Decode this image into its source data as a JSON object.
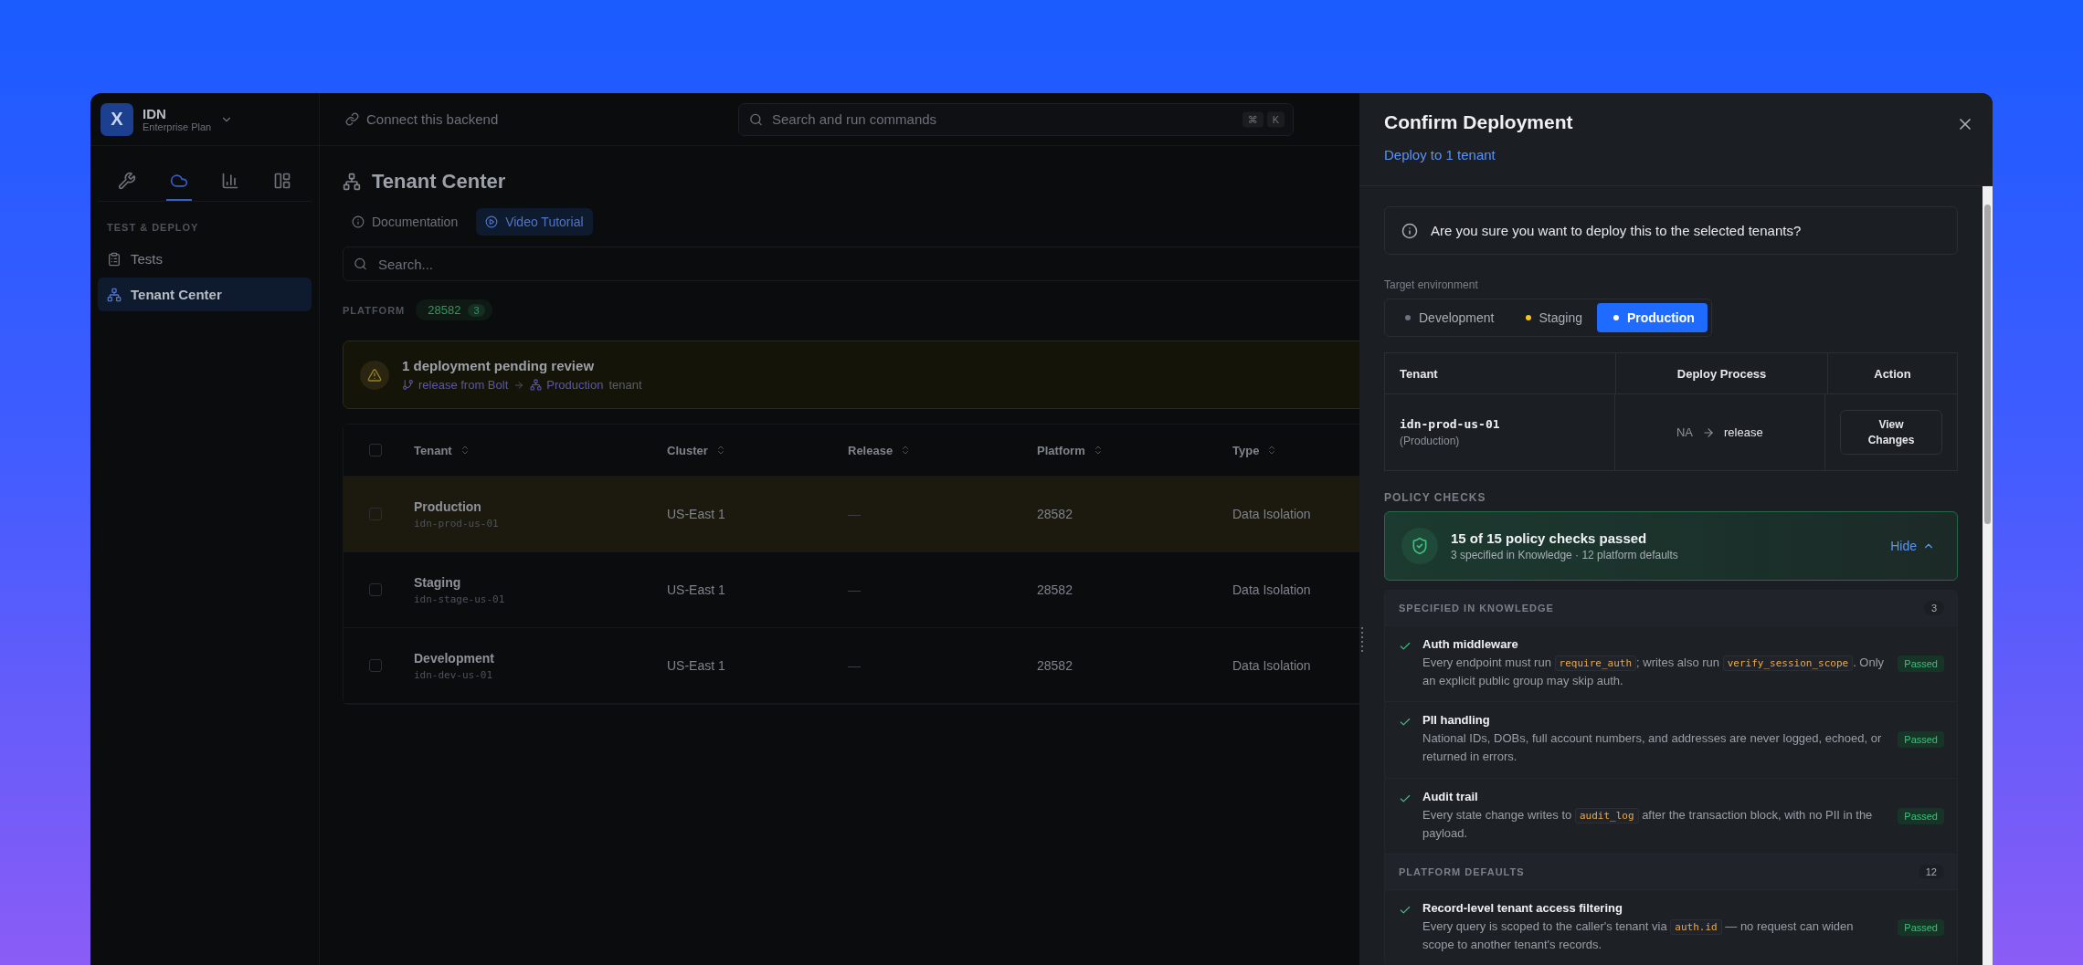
{
  "app": {
    "logo": "X",
    "name": "IDN",
    "plan": "Enterprise Plan",
    "connect": "Connect this backend",
    "search": {
      "placeholder": "Search and run commands"
    },
    "shortcut": [
      "⌘",
      "K"
    ]
  },
  "sidebar": {
    "tabs": [
      {
        "kind": "wrench",
        "selected": false
      },
      {
        "kind": "cloud",
        "selected": true
      },
      {
        "kind": "chart",
        "selected": false
      },
      {
        "kind": "layout",
        "selected": false
      }
    ],
    "section": "TEST & DEPLOY",
    "items": [
      {
        "label": "Tests",
        "kind": "clipboard",
        "selected": false
      },
      {
        "label": "Tenant Center",
        "kind": "tree",
        "selected": true
      }
    ]
  },
  "main": {
    "title": "Tenant Center",
    "tabs": [
      {
        "label": "Documentation",
        "kind": "info",
        "selected": false
      },
      {
        "label": "Video Tutorial",
        "kind": "play",
        "selected": true
      }
    ],
    "search": {
      "placeholder": "Search..."
    },
    "platform": {
      "label": "PLATFORM",
      "value": "28582",
      "count": "3"
    },
    "alert": {
      "title": "1 deployment pending review",
      "source": "release from Bolt",
      "target": "Production",
      "suffix": "tenant"
    },
    "table": {
      "checked": false,
      "columns": [
        "Tenant",
        "Cluster",
        "Release",
        "Platform",
        "Type"
      ],
      "rows": [
        {
          "name": "Production",
          "id": "idn-prod-us-01",
          "cluster": "US-East 1",
          "release": "—",
          "platform": "28582",
          "type": "Data Isolation",
          "checked": false,
          "pending": true
        },
        {
          "name": "Staging",
          "id": "idn-stage-us-01",
          "cluster": "US-East 1",
          "release": "—",
          "platform": "28582",
          "type": "Data Isolation",
          "checked": false,
          "pending": false
        },
        {
          "name": "Development",
          "id": "idn-dev-us-01",
          "cluster": "US-East 1",
          "release": "—",
          "platform": "28582",
          "type": "Data Isolation",
          "checked": false,
          "pending": false
        }
      ]
    }
  },
  "drawer": {
    "title": "Confirm Deployment",
    "subtitle": "Deploy to 1 tenant",
    "notice": "Are you sure you want to deploy this to the selected tenants?",
    "environment": {
      "label": "Target environment",
      "options": [
        {
          "label": "Development",
          "color": "#6b7280",
          "selected": false
        },
        {
          "label": "Staging",
          "color": "#f5c518",
          "selected": false
        },
        {
          "label": "Production",
          "color": "#ffffff",
          "selected": true
        }
      ]
    },
    "tenants_table": {
      "columns": [
        "Tenant",
        "Deploy Process",
        "Action"
      ],
      "rows": [
        {
          "tenant": "idn-prod-us-01",
          "environment": "(Production)",
          "from": "NA",
          "to": "release",
          "action": "View Changes"
        }
      ]
    },
    "policy": {
      "heading": "POLICY CHECKS",
      "summary": {
        "title": "15 of 15 policy checks passed",
        "detail": "3 specified in Knowledge · 12 platform defaults",
        "toggle": "Hide",
        "expanded": true
      },
      "groups": [
        {
          "title": "SPECIFIED IN KNOWLEDGE",
          "count": "3",
          "checks": [
            {
              "title": "Auth middleware",
              "status": "Passed",
              "passed": true,
              "parts": [
                {
                  "kind": "text",
                  "text": "Every endpoint must run "
                },
                {
                  "kind": "code",
                  "text": "require_auth"
                },
                {
                  "kind": "text",
                  "text": "; writes also run "
                },
                {
                  "kind": "code",
                  "text": "verify_session_scope"
                },
                {
                  "kind": "text",
                  "text": ". Only an explicit public group may skip auth."
                }
              ]
            },
            {
              "title": "PII handling",
              "status": "Passed",
              "passed": true,
              "parts": [
                {
                  "kind": "text",
                  "text": "National IDs, DOBs, full account numbers, and addresses are never logged, echoed, or returned in errors."
                }
              ]
            },
            {
              "title": "Audit trail",
              "status": "Passed",
              "passed": true,
              "parts": [
                {
                  "kind": "text",
                  "text": "Every state change writes to "
                },
                {
                  "kind": "code",
                  "text": "audit_log"
                },
                {
                  "kind": "text",
                  "text": " after the transaction block, with no PII in the payload."
                }
              ]
            }
          ]
        },
        {
          "title": "PLATFORM DEFAULTS",
          "count": "12",
          "checks": [
            {
              "title": "Record-level tenant access filtering",
              "status": "Passed",
              "passed": true,
              "parts": [
                {
                  "kind": "text",
                  "text": "Every query is scoped to the caller's tenant via "
                },
                {
                  "kind": "code",
                  "text": "auth.id"
                },
                {
                  "kind": "text",
                  "text": " — no request can widen scope to another tenant's records."
                }
              ]
            }
          ]
        }
      ]
    }
  }
}
